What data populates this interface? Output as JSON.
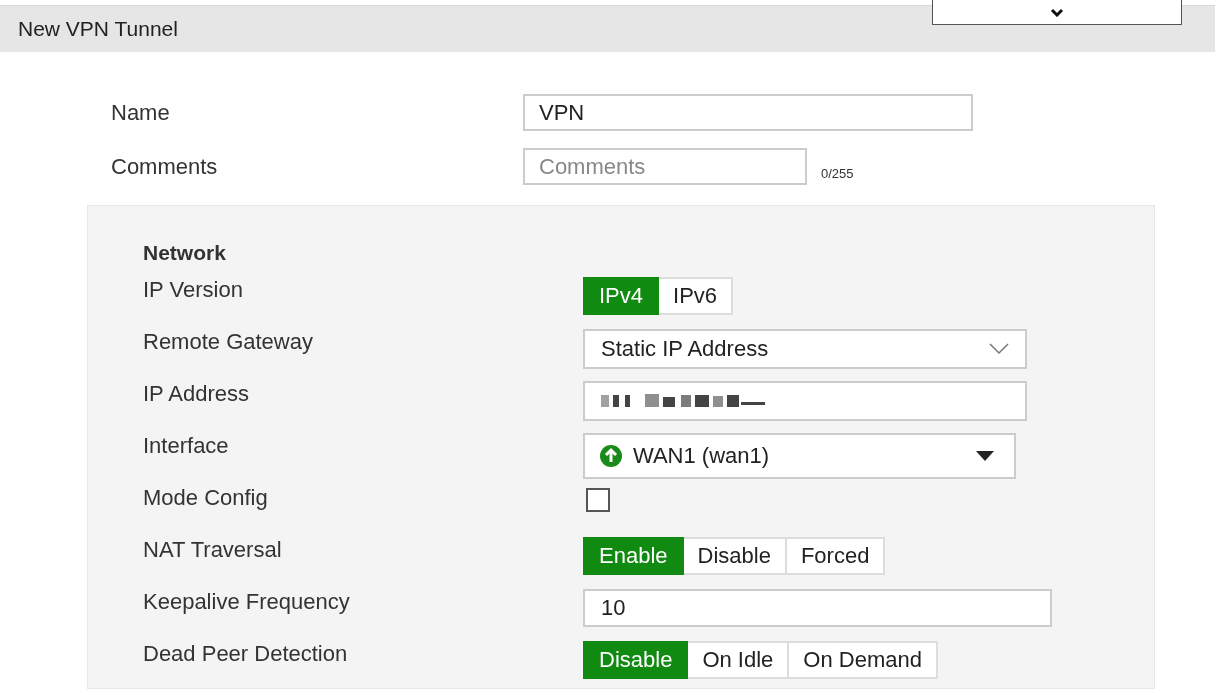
{
  "header": {
    "title": "New VPN Tunnel"
  },
  "top_fields": [
    {
      "label": "Name",
      "kind": "text",
      "value": "VPN"
    },
    {
      "label": "Comments",
      "kind": "textarea",
      "placeholder": "Comments",
      "counter": "0/255"
    }
  ],
  "network": {
    "heading": "Network",
    "rows": [
      {
        "label": "IP Version",
        "kind": "segmented",
        "options": [
          {
            "label": "IPv4",
            "selected": true
          },
          {
            "label": "IPv6",
            "selected": false
          }
        ]
      },
      {
        "label": "Remote Gateway",
        "kind": "select",
        "value": "Static IP Address"
      },
      {
        "label": "IP Address",
        "kind": "redacted"
      },
      {
        "label": "Interface",
        "kind": "interface",
        "value": "WAN1 (wan1)",
        "link_up": true
      },
      {
        "label": "Mode Config",
        "kind": "checkbox",
        "checked": false
      },
      {
        "label": "NAT Traversal",
        "kind": "segmented",
        "options": [
          {
            "label": "Enable",
            "selected": true
          },
          {
            "label": "Disable",
            "selected": false
          },
          {
            "label": "Forced",
            "selected": false
          }
        ]
      },
      {
        "label": "Keepalive Frequency",
        "kind": "text",
        "value": "10"
      },
      {
        "label": "Dead Peer Detection",
        "kind": "segmented",
        "options": [
          {
            "label": "Disable",
            "selected": true
          },
          {
            "label": "On Idle",
            "selected": false
          },
          {
            "label": "On Demand",
            "selected": false
          }
        ]
      }
    ]
  }
}
